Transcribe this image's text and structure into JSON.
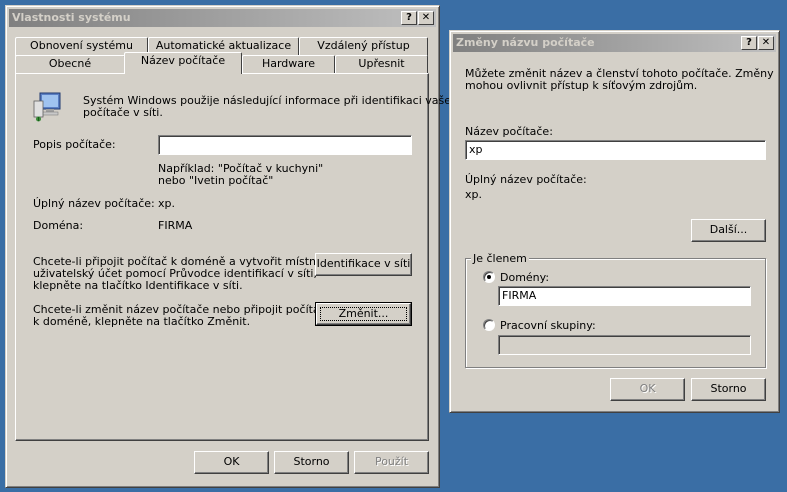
{
  "dialog1": {
    "title": "Vlastnosti systému",
    "help_button": "?",
    "close_button": "✕",
    "tabs_back": [
      "Obnovení systému",
      "Automatické aktualizace",
      "Vzdálený přístup"
    ],
    "tabs_front": [
      "Obecné",
      "Název počítače",
      "Hardware",
      "Upřesnit"
    ],
    "active_tab": "Název počítače",
    "intro_line1": "Systém Windows použije následující informace při identifikaci vašeho",
    "intro_line2": "počítače v síti.",
    "description_label": "Popis počítače:",
    "description_value": "",
    "example_line1": "Například: \"Počítač v kuchyni\"",
    "example_line2": "nebo \"Ivetin počítač\"",
    "fullname_label": "Úplný název počítače:",
    "fullname_value": "xp.",
    "domain_label": "Doména:",
    "domain_value": "FIRMA",
    "wizard_text_line1": "Chcete-li připojit počítač k doméně a vytvořit místní",
    "wizard_text_line2": "uživatelský účet pomocí Průvodce identifikací v síti,",
    "wizard_text_line3": "klepněte na tlačítko Identifikace v síti.",
    "network_id_button": "Identifikace v síti",
    "rename_text_line1": "Chcete-li změnit název počítače nebo připojit počítač",
    "rename_text_line2": "k doméně, klepněte na tlačítko Změnit.",
    "change_button": "Změnit...",
    "ok_button": "OK",
    "cancel_button": "Storno",
    "apply_button": "Použít"
  },
  "dialog2": {
    "title": "Změny názvu počítače",
    "help_button": "?",
    "close_button": "✕",
    "intro_line1": "Můžete změnit název a členství tohoto počítače. Změny",
    "intro_line2": "mohou ovlivnit přístup k síťovým zdrojům.",
    "name_label": "Název počítače:",
    "name_value": "xp",
    "fullname_label": "Úplný název počítače:",
    "fullname_value": "xp.",
    "more_button": "Další...",
    "member_legend": "Je členem",
    "domain_radio_label": "Domény:",
    "domain_value": "FIRMA",
    "workgroup_radio_label": "Pracovní skupiny:",
    "workgroup_value": "",
    "selected_membership": "Domény",
    "ok_button": "OK",
    "cancel_button": "Storno"
  }
}
